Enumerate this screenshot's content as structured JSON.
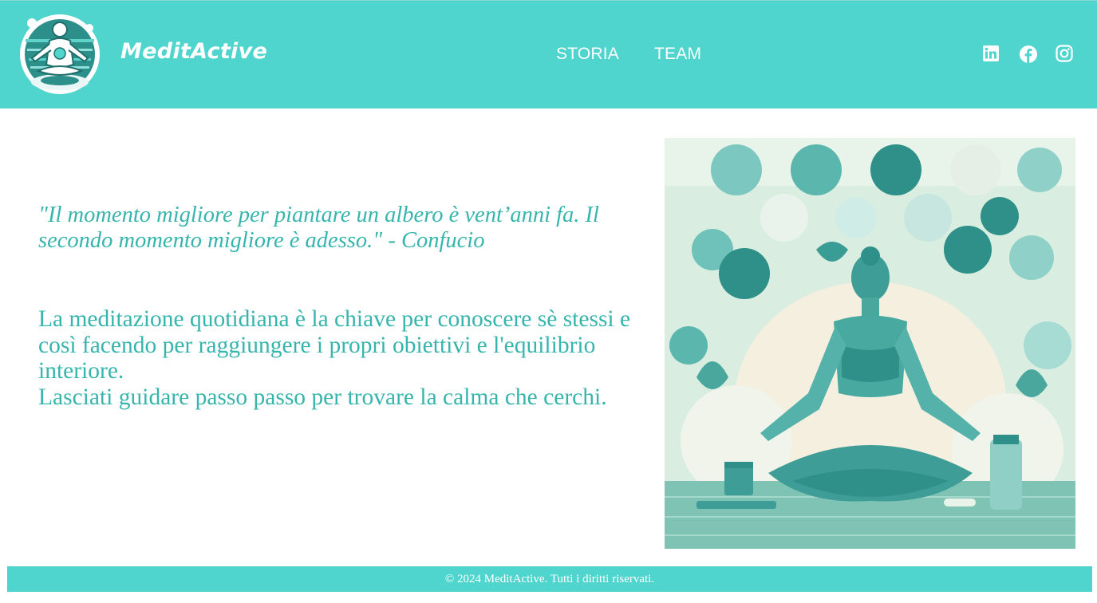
{
  "brand": {
    "name": "MeditActive",
    "logo_icon": "meditation-lotus-logo",
    "accent_color": "#4fd4ce",
    "text_color": "#36b5ad"
  },
  "nav": {
    "items": [
      {
        "label": "STORIA"
      },
      {
        "label": "TEAM"
      }
    ]
  },
  "social": {
    "icons": [
      "linkedin-icon",
      "facebook-icon",
      "instagram-icon"
    ]
  },
  "main": {
    "quote": "\"Il momento migliore per piantare un albero è vent’anni fa. Il secondo momento migliore è adesso.\" - Confucio",
    "paragraph_1": "La meditazione quotidiana è la chiave per conoscere sè stessi e così facendo per raggiungere i propri obiettivi e l'equilibrio interiore.",
    "paragraph_2": "Lasciati guidare passo passo per trovare la calma che cerchi.",
    "hero_image": "woman-meditating-illustration"
  },
  "footer": {
    "text": "© 2024 MeditActive. Tutti i diritti riservati."
  }
}
